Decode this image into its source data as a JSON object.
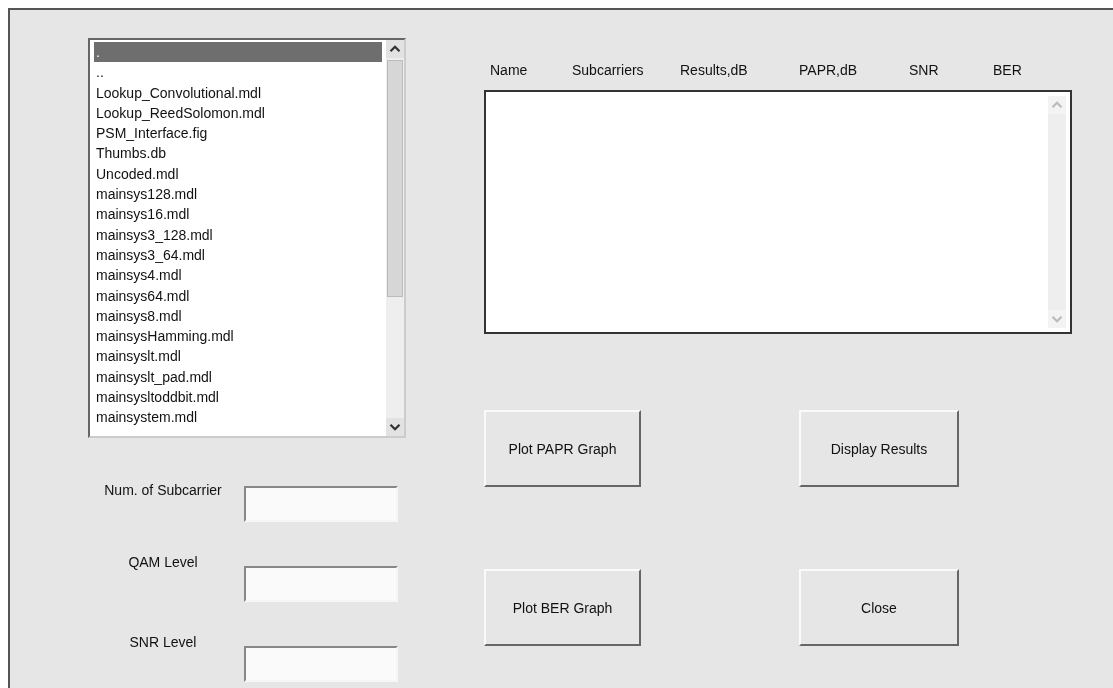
{
  "file_list": {
    "items": [
      {
        "label": ".",
        "selected": true
      },
      {
        "label": "..",
        "selected": false
      },
      {
        "label": "Lookup_Convolutional.mdl",
        "selected": false
      },
      {
        "label": "Lookup_ReedSolomon.mdl",
        "selected": false
      },
      {
        "label": "PSM_Interface.fig",
        "selected": false
      },
      {
        "label": "Thumbs.db",
        "selected": false
      },
      {
        "label": "Uncoded.mdl",
        "selected": false
      },
      {
        "label": "mainsys128.mdl",
        "selected": false
      },
      {
        "label": "mainsys16.mdl",
        "selected": false
      },
      {
        "label": "mainsys3_128.mdl",
        "selected": false
      },
      {
        "label": "mainsys3_64.mdl",
        "selected": false
      },
      {
        "label": "mainsys4.mdl",
        "selected": false
      },
      {
        "label": "mainsys64.mdl",
        "selected": false
      },
      {
        "label": "mainsys8.mdl",
        "selected": false
      },
      {
        "label": "mainsysHamming.mdl",
        "selected": false
      },
      {
        "label": "mainsyslt.mdl",
        "selected": false
      },
      {
        "label": "mainsyslt_pad.mdl",
        "selected": false
      },
      {
        "label": "mainsysltoddbit.mdl",
        "selected": false
      },
      {
        "label": "mainsystem.mdl",
        "selected": false
      }
    ]
  },
  "fields": [
    {
      "label": "Num. of Subcarrier"
    },
    {
      "label": "QAM Level"
    },
    {
      "label": "SNR Level"
    }
  ],
  "results_table": {
    "columns": [
      "Name",
      "Subcarriers",
      "Results,dB",
      "PAPR,dB",
      "SNR",
      "BER"
    ]
  },
  "buttons": [
    "Plot PAPR Graph",
    "Display Results",
    "Plot BER Graph",
    "Close"
  ]
}
